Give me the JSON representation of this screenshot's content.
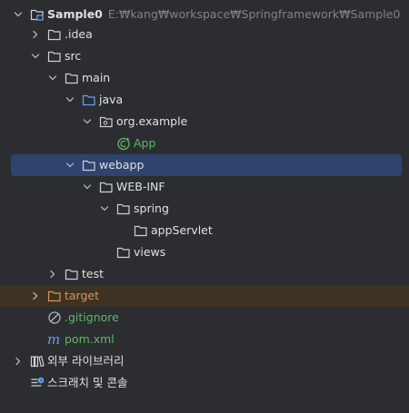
{
  "project": {
    "name": "Sample0",
    "path": "E:₩kang₩workspace₩Springframework₩Sample0"
  },
  "tree": {
    "idea": ".idea",
    "src": "src",
    "main": "main",
    "java": "java",
    "package": "org.example",
    "app": "App",
    "webapp": "webapp",
    "webinf": "WEB-INF",
    "spring": "spring",
    "appservlet": "appServlet",
    "views": "views",
    "test": "test",
    "target": "target",
    "gitignore": ".gitignore",
    "pom": "pom.xml",
    "external_libraries": "외부 라이브러리",
    "scratches": "스크래치 및 콘솔"
  },
  "colors": {
    "background": "#2b2d30",
    "selected_row": "#2e436e",
    "excluded_row": "#3d3223",
    "green_text": "#5fb865",
    "orange_text": "#d9945a",
    "folder_icon": "#ced0d6",
    "source_folder_icon": "#6c9ef8"
  },
  "icons": {
    "folder": "folder-icon",
    "source_folder": "source-folder-icon",
    "package": "package-icon",
    "class": "spring-class-icon",
    "gitignore": "ignore-icon",
    "maven": "maven-icon",
    "library": "library-icon",
    "scratches": "scratches-icon",
    "module": "module-icon"
  }
}
